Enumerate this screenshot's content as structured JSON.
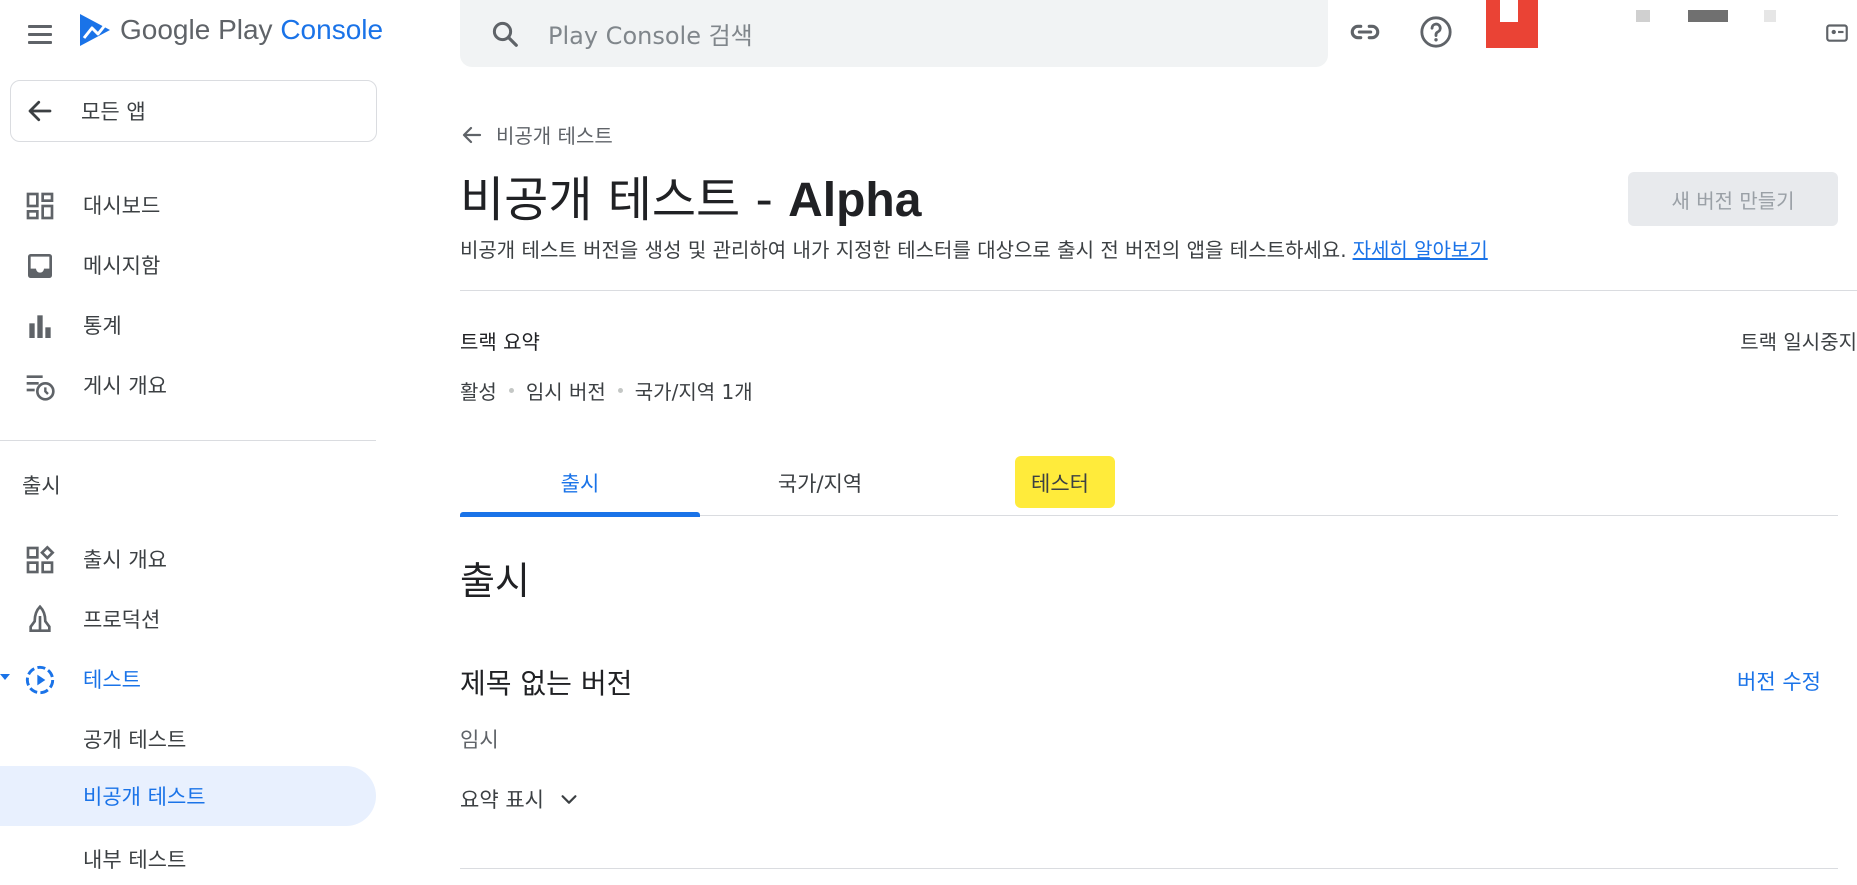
{
  "app": {
    "product_name": "Google Play",
    "product_suffix": "Console"
  },
  "search": {
    "placeholder": "Play Console 검색"
  },
  "sidebar": {
    "all_apps": "모든 앱",
    "items": [
      {
        "label": "대시보드",
        "icon": "dashboard-icon"
      },
      {
        "label": "메시지함",
        "icon": "inbox-icon"
      },
      {
        "label": "통계",
        "icon": "bar-chart-icon"
      },
      {
        "label": "게시 개요",
        "icon": "publishing-overview-icon"
      }
    ],
    "release_section": "출시",
    "release_items": [
      {
        "label": "출시 개요",
        "icon": "release-overview-icon"
      },
      {
        "label": "프로덕션",
        "icon": "rocket-icon"
      },
      {
        "label": "테스트",
        "icon": "testing-icon"
      },
      {
        "label": "공개 테스트"
      },
      {
        "label": "비공개 테스트"
      },
      {
        "label": "내부 테스트"
      }
    ]
  },
  "page": {
    "back_label": "비공개 테스트",
    "title_prefix": "비공개 테스트 - ",
    "title_suffix": "Alpha",
    "new_release_button": "새 버전 만들기",
    "description": "비공개 테스트 버전을 생성 및 관리하여 내가 지정한 테스터를 대상으로 출시 전 버전의 앱을 테스트하세요.",
    "learn_more": "자세히 알아보기",
    "track_summary": "트랙 요약",
    "pause_track": "트랙 일시중지",
    "status": [
      "활성",
      "임시 버전",
      "국가/지역 1개"
    ],
    "tabs": [
      "출시",
      "국가/지역",
      "테스터"
    ],
    "section_heading": "출시",
    "release_title": "제목 없는 버전",
    "edit_release": "버전 수정",
    "release_status": "임시",
    "show_summary": "요약 표시"
  },
  "colors": {
    "accent": "#1a73e8",
    "highlight": "#ffeb3b",
    "selected_bg": "#e8f0fe",
    "avatar": "#ea4335"
  }
}
